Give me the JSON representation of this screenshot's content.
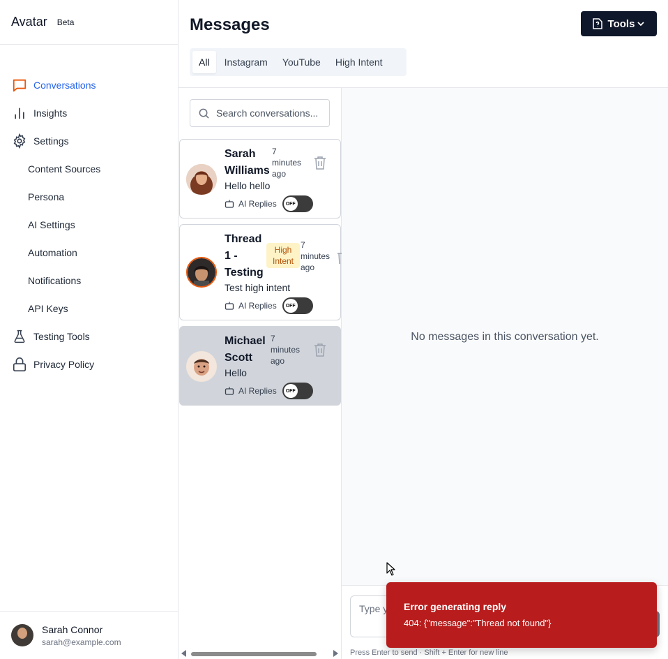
{
  "brand": {
    "name": "Avatar",
    "badge": "Beta"
  },
  "nav": {
    "items": [
      {
        "label": "Conversations",
        "icon": "chat-bubble-icon"
      },
      {
        "label": "Insights",
        "icon": "bar-chart-icon"
      },
      {
        "label": "Settings",
        "icon": "gear-icon"
      },
      {
        "label": "Content Sources"
      },
      {
        "label": "Persona"
      },
      {
        "label": "AI Settings"
      },
      {
        "label": "Automation"
      },
      {
        "label": "Notifications"
      },
      {
        "label": "API Keys"
      },
      {
        "label": "Testing Tools",
        "icon": "flask-icon"
      },
      {
        "label": "Privacy Policy",
        "icon": "lock-icon"
      }
    ]
  },
  "user": {
    "name": "Sarah Connor",
    "email": "sarah@example.com"
  },
  "header": {
    "title": "Messages",
    "tools_label": "Tools",
    "tabs": [
      "All",
      "Instagram",
      "YouTube",
      "High Intent"
    ]
  },
  "search": {
    "placeholder": "Search conversations..."
  },
  "conversations": [
    {
      "name_line1": "Sarah",
      "name_line2": "Williams",
      "time_line1": "7",
      "time_line2": "minutes",
      "time_line3": "ago",
      "preview": "Hello hello",
      "ai_label": "AI Replies",
      "toggle": "OFF"
    },
    {
      "name_line1": "Thread",
      "name_line2": "1 -",
      "name_line3": "Testing",
      "badge_line1": "High",
      "badge_line2": "Intent",
      "time_line1": "7",
      "time_line2": "minutes",
      "time_line3": "ago",
      "preview": "Test high intent",
      "ai_label": "AI Replies",
      "toggle": "OFF"
    },
    {
      "name_line1": "Michael",
      "name_line2": "Scott",
      "time_line1": "7",
      "time_line2": "minutes",
      "time_line3": "ago",
      "preview": "Hello",
      "ai_label": "AI Replies",
      "toggle": "OFF"
    }
  ],
  "pane": {
    "empty_text": "No messages in this conversation yet."
  },
  "composer": {
    "placeholder": "Type y",
    "hint": "Press Enter to send · Shift + Enter for new line"
  },
  "toast": {
    "title": "Error generating reply",
    "body": "404: {\"message\":\"Thread not found\"}"
  },
  "colors": {
    "accent": "#2563eb",
    "dark": "#0f172a",
    "error": "#b91c1c",
    "badge_bg": "#fef3c7",
    "badge_fg": "#b45309"
  }
}
